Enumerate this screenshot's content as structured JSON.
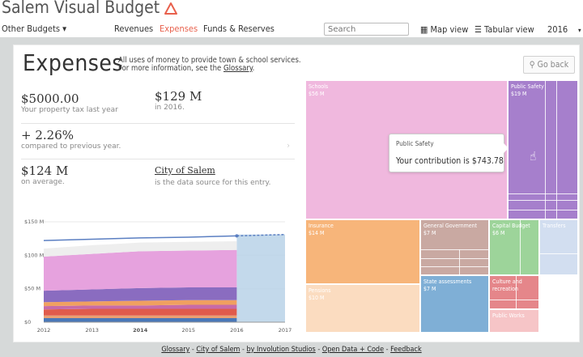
{
  "header": {
    "title": "Salem Visual Budget",
    "other_budgets": "Other Budgets",
    "nav": [
      "Revenues",
      "Expenses",
      "Funds & Reserves"
    ],
    "search_placeholder": "Search",
    "map_view": "Map view",
    "tabular_view": "Tabular view",
    "year": "2016",
    "accent_color": "#e8604c"
  },
  "page": {
    "title": "Expenses",
    "desc_line1": "All uses of money to provide town & school services.",
    "desc_line2_prefix": "For more information, see the ",
    "glossary_link": "Glossary",
    "desc_line2_suffix": ".",
    "go_back": "Go back"
  },
  "stats": {
    "tax_value": "$5000.00",
    "tax_label": "Your property tax last year",
    "amount_value": "$129 M",
    "amount_label": "in 2016.",
    "change_value": "+ 2.26%",
    "change_label": "compared to previous year.",
    "avg_value": "$124 M",
    "avg_label": "on average.",
    "source_link": "City of Salem",
    "source_label": "is the data source for this entry."
  },
  "chart_data": {
    "type": "area",
    "x": [
      2012,
      2013,
      2014,
      2015,
      2016,
      2017
    ],
    "x_tick_labels": [
      "2012",
      "2013",
      "2014",
      "2015",
      "2016",
      "2017"
    ],
    "y_tick_labels": [
      "$150 M",
      "$100 M",
      "$50 M",
      "$0"
    ],
    "ylim": [
      0,
      150
    ],
    "series": [
      {
        "color": "#4a78b8",
        "values": [
          6,
          6,
          6,
          6,
          6
        ]
      },
      {
        "color": "#e9a072",
        "values": [
          4,
          4,
          4,
          4,
          4
        ]
      },
      {
        "color": "#e05b4c",
        "values": [
          9,
          10,
          10,
          10,
          10
        ]
      },
      {
        "color": "#c76ba8",
        "values": [
          5,
          5,
          5,
          6,
          6
        ]
      },
      {
        "color": "#f0a060",
        "values": [
          6,
          6,
          7,
          7,
          7
        ]
      },
      {
        "color": "#8a6cc0",
        "values": [
          17,
          18,
          19,
          19,
          19
        ]
      },
      {
        "color": "#e6a2de",
        "values": [
          51,
          53,
          55,
          55,
          56
        ]
      },
      {
        "color": "#eeeeee",
        "values": [
          12,
          13,
          13,
          13,
          13
        ]
      }
    ],
    "total_line": [
      122,
      124,
      126,
      127,
      129,
      131
    ],
    "projection_from": 2016,
    "projection_color": "#b8d2e8",
    "grid": true
  },
  "treemap": [
    {
      "name": "Schools",
      "value": "$56 M",
      "color": "#f0b8de"
    },
    {
      "name": "Public Safety",
      "value": "$19 M",
      "color": "#a67fcc"
    },
    {
      "name": "Insurance",
      "value": "$14 M",
      "color": "#f7b57a"
    },
    {
      "name": "General Government",
      "value": "$7 M",
      "color": "#c9a9a2"
    },
    {
      "name": "Capital Budget",
      "value": "$6 M",
      "color": "#9dd49a"
    },
    {
      "name": "Transfers",
      "value": "",
      "color": "#d2def0"
    },
    {
      "name": "Pensions",
      "value": "$10 M",
      "color": "#fbdcc0"
    },
    {
      "name": "State assessments",
      "value": "$7 M",
      "color": "#7fafd6"
    },
    {
      "name": "Culture and recreation",
      "value": "",
      "color": "#e5868a"
    },
    {
      "name": "Public Works",
      "value": "",
      "color": "#f6c5c7"
    }
  ],
  "tooltip": {
    "title": "Public Safety",
    "body": "Your contribution is $743.78"
  },
  "footer": {
    "links": [
      "Glossary",
      "City of Salem",
      "by Involution Studios",
      "Open Data + Code",
      "Feedback"
    ],
    "separator": " - "
  }
}
